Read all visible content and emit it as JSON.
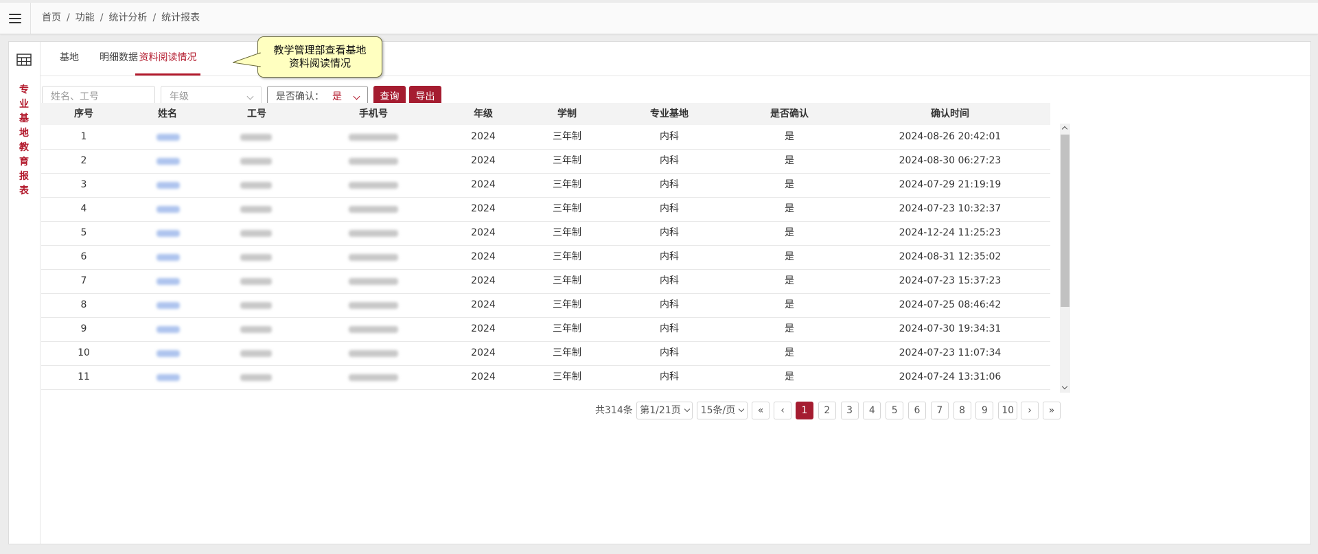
{
  "breadcrumb": [
    "首页",
    "功能",
    "统计分析",
    "统计报表"
  ],
  "sidebar_title_chars": [
    "专",
    "业",
    "基",
    "地",
    "教",
    "育",
    "报",
    "表"
  ],
  "tabs": [
    {
      "label": "基地"
    },
    {
      "label": "明细数据"
    },
    {
      "label": "资料阅读情况",
      "active": true
    }
  ],
  "callout": {
    "line1": "教学管理部查看基地",
    "line2": "资料阅读情况"
  },
  "filters": {
    "name_placeholder": "姓名、工号",
    "grade_placeholder": "年级",
    "confirm_label": "是否确认：",
    "confirm_value": "是"
  },
  "buttons": {
    "query": "查询",
    "export": "导出"
  },
  "table": {
    "columns": [
      "序号",
      "姓名",
      "工号",
      "手机号",
      "年级",
      "学制",
      "专业基地",
      "是否确认",
      "确认时间"
    ],
    "rows": [
      {
        "no": "1",
        "grade": "2024",
        "system": "三年制",
        "base": "内科",
        "confirmed": "是",
        "time": "2024-08-26 20:42:01"
      },
      {
        "no": "2",
        "grade": "2024",
        "system": "三年制",
        "base": "内科",
        "confirmed": "是",
        "time": "2024-08-30 06:27:23"
      },
      {
        "no": "3",
        "grade": "2024",
        "system": "三年制",
        "base": "内科",
        "confirmed": "是",
        "time": "2024-07-29 21:19:19"
      },
      {
        "no": "4",
        "grade": "2024",
        "system": "三年制",
        "base": "内科",
        "confirmed": "是",
        "time": "2024-07-23 10:32:37"
      },
      {
        "no": "5",
        "grade": "2024",
        "system": "三年制",
        "base": "内科",
        "confirmed": "是",
        "time": "2024-12-24 11:25:23"
      },
      {
        "no": "6",
        "grade": "2024",
        "system": "三年制",
        "base": "内科",
        "confirmed": "是",
        "time": "2024-08-31 12:35:02"
      },
      {
        "no": "7",
        "grade": "2024",
        "system": "三年制",
        "base": "内科",
        "confirmed": "是",
        "time": "2024-07-23 15:37:23"
      },
      {
        "no": "8",
        "grade": "2024",
        "system": "三年制",
        "base": "内科",
        "confirmed": "是",
        "time": "2024-07-25 08:46:42"
      },
      {
        "no": "9",
        "grade": "2024",
        "system": "三年制",
        "base": "内科",
        "confirmed": "是",
        "time": "2024-07-30 19:34:31"
      },
      {
        "no": "10",
        "grade": "2024",
        "system": "三年制",
        "base": "内科",
        "confirmed": "是",
        "time": "2024-07-23 11:07:34"
      },
      {
        "no": "11",
        "grade": "2024",
        "system": "三年制",
        "base": "内科",
        "confirmed": "是",
        "time": "2024-07-24 13:31:06"
      }
    ]
  },
  "pagination": {
    "total": "共314条",
    "page_info": "第1/21页",
    "page_size": "15条/页",
    "first": "«",
    "prev": "‹",
    "pages": [
      "1",
      "2",
      "3",
      "4",
      "5",
      "6",
      "7",
      "8",
      "9",
      "10"
    ],
    "current": "1",
    "next": "›",
    "last": "»"
  },
  "colors": {
    "accent": "#a51c30",
    "callout_bg": "#ffffc0",
    "blur_name": "#aec4ee"
  },
  "icons": [
    "hamburger-menu-icon",
    "table-grid-icon"
  ]
}
